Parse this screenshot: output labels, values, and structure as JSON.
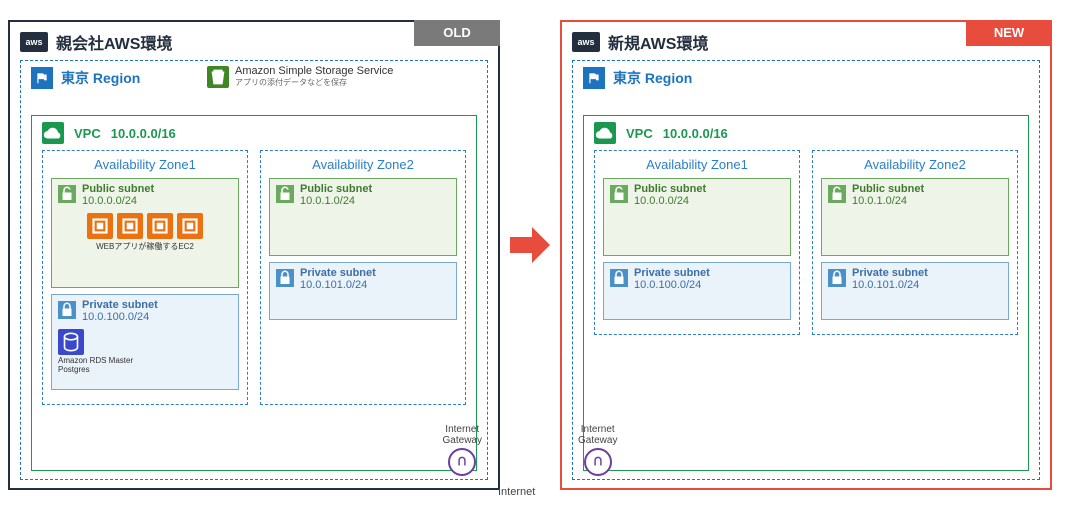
{
  "badges": {
    "old": "OLD",
    "new": "NEW"
  },
  "envs": {
    "old": {
      "title": "親会社AWS環境"
    },
    "new": {
      "title": "新規AWS環境"
    }
  },
  "region": {
    "title": "東京 Region"
  },
  "s3": {
    "title": "Amazon Simple Storage Service",
    "sub": "アプリの添付データなどを保存"
  },
  "vpc": {
    "label": "VPC",
    "cidr": "10.0.0.0/16"
  },
  "az": {
    "z1": "Availability Zone1",
    "z2": "Availability Zone2"
  },
  "sub": {
    "pub": {
      "label": "Public subnet"
    },
    "priv": {
      "label": "Private subnet"
    },
    "pub1": "10.0.0.0/24",
    "pub2": "10.0.1.0/24",
    "priv1": "10.0.100.0/24",
    "priv2": "10.0.101.0/24"
  },
  "ec2": {
    "note": "WEBアプリが稼働するEC2"
  },
  "rds": {
    "note": "Amazon RDS Master\nPostgres"
  },
  "igw": {
    "label": "Internet\nGateway"
  },
  "internet": "Internet"
}
